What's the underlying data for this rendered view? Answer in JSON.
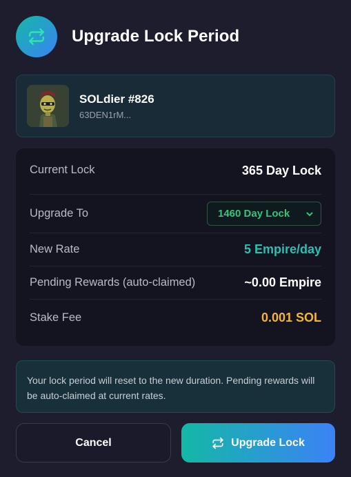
{
  "modal": {
    "title": "Upgrade Lock Period",
    "header_icon": "swap-arrows-icon"
  },
  "nft": {
    "name": "SOLdier #826",
    "address": "63DEN1rM..."
  },
  "details": {
    "current_lock": {
      "label": "Current Lock",
      "value": "365 Day Lock"
    },
    "upgrade_to": {
      "label": "Upgrade To",
      "selected": "1460 Day Lock"
    },
    "new_rate": {
      "label": "New Rate",
      "value": "5 Empire/day"
    },
    "pending_rewards": {
      "label": "Pending Rewards (auto-claimed)",
      "value": "~0.00 Empire"
    },
    "stake_fee": {
      "label": "Stake Fee",
      "value": "0.001 SOL"
    }
  },
  "notice": "Your lock period will reset to the new duration. Pending rewards will be auto-claimed at current rates.",
  "buttons": {
    "cancel": "Cancel",
    "upgrade": "Upgrade Lock"
  },
  "colors": {
    "accent_teal": "#14b8a6",
    "accent_blue": "#3b82f6",
    "rate_teal": "#2dbfb0",
    "fee_orange": "#f5b53a",
    "select_green": "#35c47b"
  }
}
